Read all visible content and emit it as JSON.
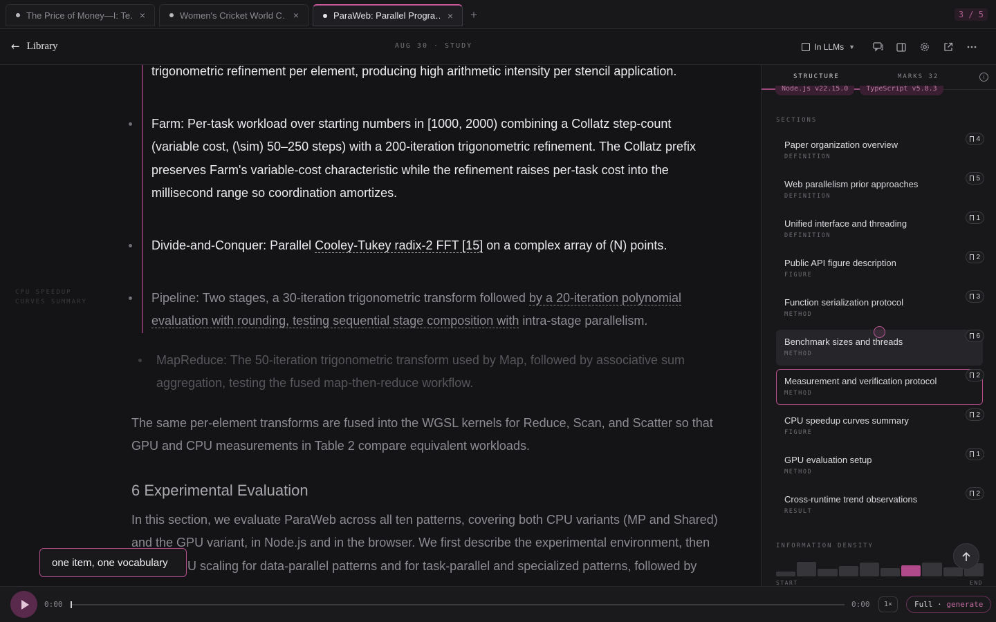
{
  "tabs": [
    {
      "title": "The Price of Money—I: Te…",
      "close": "×"
    },
    {
      "title": "Women's Cricket World C…",
      "close": "×"
    },
    {
      "title": "ParaWeb: Parallel Progra…",
      "close": "×"
    }
  ],
  "new_tab": "+",
  "tab_counter": "3 / 5",
  "header": {
    "back_label": "Library",
    "meta": "AUG 30 · STUDY",
    "model": "In LLMs"
  },
  "reader": {
    "side_label_1": "CPU SPEEDUP",
    "side_label_2": "CURVES SUMMARY",
    "top_line": "trigonometric refinement per element, producing high arithmetic intensity per stencil application.",
    "farm_1": "Farm: Per-task workload over starting numbers in [1000, 2000) combining a Collatz step-count",
    "farm_2": "(variable cost, (\\sim) 50–250 steps) with a 200-iteration trigonometric refinement. The Collatz prefix",
    "farm_3": "preserves Farm's variable-cost characteristic while the refinement raises per-task cost into the",
    "farm_4": "millisecond range so coordination amortizes.",
    "dc_pre": "Divide-and-Conquer: Parallel ",
    "dc_link": "Cooley-Tukey radix-2 FFT [15]",
    "dc_post": " on a complex array of (N) points.",
    "pipe_1a": "Pipeline: Two stages, a 30-iteration trigonometric transform followed ",
    "pipe_1b": "by a 20-iteration polynomial",
    "pipe_2a": "evaluation with rounding, testing sequential stage composition with",
    "pipe_2b": " intra-stage parallelism.",
    "mr_1": "MapReduce: The 50-iteration trigonometric transform used by Map, followed by associative sum",
    "mr_2": "aggregation, testing the fused map-then-reduce workflow.",
    "para_1": "The same per-element transforms are fused into the WGSL kernels for Reduce, Scan, and Scatter so that",
    "para_2": "GPU and CPU measurements in Table 2 compare equivalent workloads.",
    "heading": "6 Experimental Evaluation",
    "eval_1": "In this section, we evaluate ParaWeb across all ten patterns, covering both CPU variants (MP and Shared)",
    "eval_2": "and the GPU variant, in Node.js and in the browser. We first describe the experimental environment, then",
    "eval_3": "U scaling for data-parallel patterns and for task-parallel and specialized patterns, followed by"
  },
  "tooltip": "one item, one vocabulary",
  "panel": {
    "tab_structure": "STRUCTURE",
    "tab_marks": "MARKS  32",
    "pills": [
      "Node.js v22.15.0",
      "TypeScript v5.8.3"
    ],
    "sections_heading": "SECTIONS",
    "sections": [
      {
        "title": "Paper organization overview",
        "kind": "DEFINITION",
        "count": "4"
      },
      {
        "title": "Web parallelism prior approaches",
        "kind": "DEFINITION",
        "count": "5"
      },
      {
        "title": "Unified interface and threading",
        "kind": "DEFINITION",
        "count": "1"
      },
      {
        "title": "Public API figure description",
        "kind": "FIGURE",
        "count": "2"
      },
      {
        "title": "Function serialization protocol",
        "kind": "METHOD",
        "count": "3"
      },
      {
        "title": "Benchmark sizes and threads",
        "kind": "METHOD",
        "count": "6"
      },
      {
        "title": "Measurement and verification protocol",
        "kind": "METHOD",
        "count": "2"
      },
      {
        "title": "CPU speedup curves summary",
        "kind": "FIGURE",
        "count": "2"
      },
      {
        "title": "GPU evaluation setup",
        "kind": "METHOD",
        "count": "1"
      },
      {
        "title": "Cross-runtime trend observations",
        "kind": "RESULT",
        "count": "2"
      }
    ],
    "density_heading": "INFORMATION DENSITY",
    "density": [
      0.3,
      0.95,
      0.5,
      0.65,
      0.9,
      0.55,
      0.7,
      0.9,
      0.6,
      0.85
    ],
    "density_highlight_index": 6,
    "density_start": "START",
    "density_end": "END"
  },
  "player": {
    "time_start": "0:00",
    "time_end": "0:00",
    "speed": "1×",
    "mode_prefix": "Full · ",
    "mode_action": "generate",
    "progress": 0
  }
}
